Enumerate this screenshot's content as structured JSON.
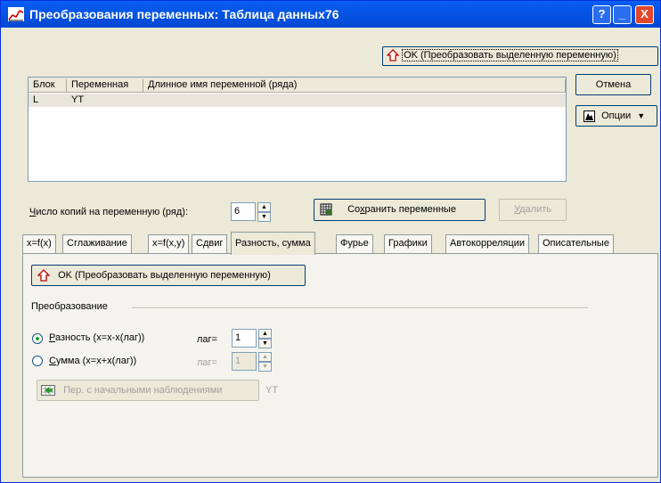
{
  "window": {
    "title": "Преобразования переменных: Таблица данных76",
    "help_label": "?",
    "minimize_label": "_",
    "close_label": "X"
  },
  "top_buttons": {
    "ok_label": "OK (Преобразовать выделенную переменную)",
    "cancel_label": "Отмена",
    "options_label": "Опции"
  },
  "variables_list": {
    "columns": [
      "Блок",
      "Переменная",
      "Длинное имя переменной (ряда)"
    ],
    "rows": [
      {
        "block": "L",
        "variable": "YT",
        "long_name": ""
      }
    ]
  },
  "copies": {
    "label_prefix": "Ч",
    "label_rest": "исло копий на переменную (ряд):",
    "value": "6",
    "save_prefix": "Со",
    "save_hot": "х",
    "save_rest": "ранить переменные",
    "delete_prefix": "У",
    "delete_rest": "далить"
  },
  "tabs": [
    "x=f(x)",
    "Сглаживание",
    "x=f(x,y)",
    "Сдвиг",
    "Разность, сумма",
    "Фурье",
    "Графики",
    "Автокорреляции",
    "Описательные"
  ],
  "active_tab": "Разность, сумма",
  "panel": {
    "ok_label": "OK (Преобразовать выделенную переменную)",
    "section_title": "Преобразование",
    "difference": {
      "prefix": "Р",
      "rest": "азность (x=x-x(лаг))",
      "lag_label": "лаг=",
      "lag_value": "1",
      "selected": true
    },
    "sum": {
      "prefix": "С",
      "rest": "умма (x=x+x(лаг))",
      "lag_label": "лаг=",
      "lag_value": "1",
      "selected": false
    },
    "initial_button_label": "Пер. с начальными наблюдениями",
    "initial_var": "YT"
  }
}
